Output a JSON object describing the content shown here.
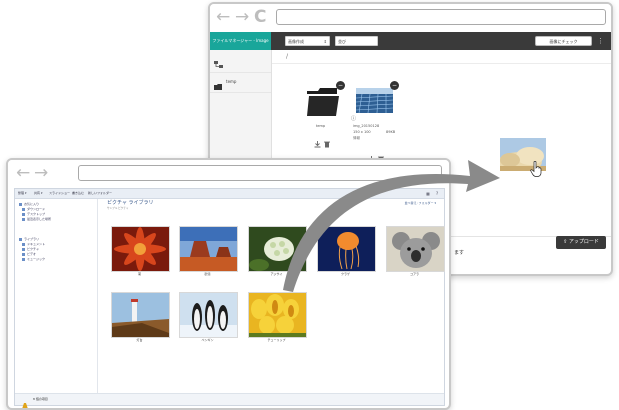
{
  "file_manager": {
    "nav": {
      "back_icon": "←",
      "forward_icon": "→",
      "reload_icon": "C"
    },
    "app_name": "ファイルマネージャー - Image",
    "view_select": "画像作成",
    "sort_select": "並び",
    "select_button": "画像にチェック",
    "menu_icon": "⋮",
    "sidebar_items": [
      {
        "label": ""
      },
      {
        "label": "temp"
      }
    ],
    "breadcrumb": "/",
    "folder": {
      "name": "temp"
    },
    "image_file": {
      "name": "img_20150128",
      "dims": "150 x 100",
      "size": "89KB",
      "info": "情報"
    },
    "upload_button": "アップロード",
    "upload_icon": "⇪",
    "fragment_text": "ます"
  },
  "explorer": {
    "nav": {
      "back_icon": "←",
      "forward_icon": "→"
    },
    "commands": [
      "整理 ▾",
      "共有 ▾",
      "スライドショー",
      "書き込む",
      "新しいフォルダー"
    ],
    "nav_tree": [
      {
        "label": "お気に入り"
      },
      {
        "label": "ダウンロード"
      },
      {
        "label": "デスクトップ"
      },
      {
        "label": "最近表示した場所"
      },
      {
        "label": "ライブラリ"
      },
      {
        "label": "ドキュメント"
      },
      {
        "label": "ピクチャ"
      },
      {
        "label": "ビデオ"
      },
      {
        "label": "ミュージック"
      }
    ],
    "library_title": "ピクチャ ライブラリ",
    "library_subtitle": "サンプル ピクチャ",
    "arrange_label": "並べ替え: フォルダー ▾",
    "pictures": [
      {
        "name": "菊"
      },
      {
        "name": "砂漠"
      },
      {
        "name": "アジサイ"
      },
      {
        "name": "クラゲ"
      },
      {
        "name": "コアラ"
      },
      {
        "name": "灯台"
      },
      {
        "name": "ペンギン"
      },
      {
        "name": "チューリップ"
      }
    ],
    "status_text": "8 個の項目"
  },
  "colors": {
    "accent": "#19a69a",
    "toolbar": "#3a3a3a",
    "arrow": "#8a8a8a"
  }
}
